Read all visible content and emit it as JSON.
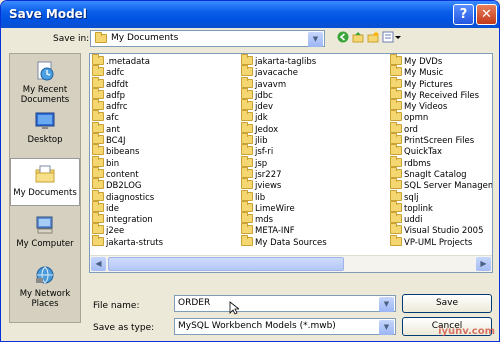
{
  "window": {
    "title": "Save Model",
    "help_label": "?",
    "close_label": "✕"
  },
  "toolbar": {
    "save_in_label": "Save in:",
    "location": "My Documents",
    "nav_icons": [
      "back-icon",
      "up-folder-icon",
      "new-folder-icon",
      "view-menu-icon"
    ]
  },
  "places": [
    {
      "label": "My Recent Documents",
      "icon": "recent-documents-icon"
    },
    {
      "label": "Desktop",
      "icon": "desktop-icon"
    },
    {
      "label": "My Documents",
      "icon": "my-documents-icon",
      "active": true
    },
    {
      "label": "My Computer",
      "icon": "my-computer-icon"
    },
    {
      "label": "My Network Places",
      "icon": "network-places-icon"
    }
  ],
  "files": {
    "col1": [
      ".metadata",
      "adfc",
      "adfdt",
      "adfp",
      "adfrc",
      "afc",
      "ant",
      "BC4J",
      "bibeans",
      "bin",
      "content",
      "DB2LOG",
      "diagnostics",
      "ide",
      "integration",
      "j2ee",
      "jakarta-struts"
    ],
    "col2": [
      "jakarta-taglibs",
      "javacache",
      "javavm",
      "jdbc",
      "jdev",
      "jdk",
      "Jedox",
      "jlib",
      "jsf-ri",
      "jsp",
      "jsr227",
      "jviews",
      "lib",
      "LimeWire",
      "mds",
      "META-INF",
      "My Data Sources"
    ],
    "col3": [
      "My DVDs",
      "My Music",
      "My Pictures",
      "My Received Files",
      "My Videos",
      "opmn",
      "ord",
      "PrintScreen Files",
      "QuickTax",
      "rdbms",
      "SnagIt Catalog",
      "SQL Server Managem",
      "sqlj",
      "toplink",
      "uddi",
      "Visual Studio 2005",
      "VP-UML Projects"
    ]
  },
  "form": {
    "file_name_label": "File name:",
    "file_name_value": "ORDER",
    "save_as_label": "Save as type:",
    "save_as_value": "MySQL Workbench Models (*.mwb)",
    "save_button": "Save",
    "cancel_button": "Cancel"
  },
  "watermark": "iyunv.com"
}
